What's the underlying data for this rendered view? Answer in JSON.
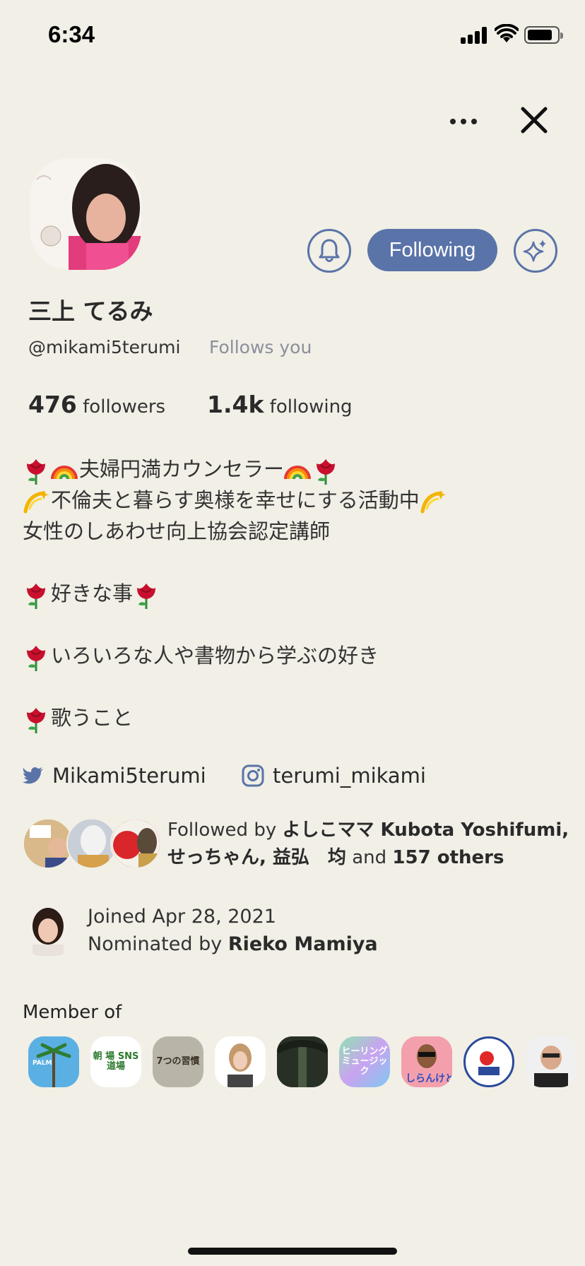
{
  "status": {
    "time": "6:34"
  },
  "profile": {
    "name": "三上 てるみ",
    "handle": "@mikami5terumi",
    "follows_you": "Follows you",
    "following_label": "Following"
  },
  "stats": {
    "followers_count": "476",
    "followers_label": "followers",
    "following_count": "1.4k",
    "following_label": "following"
  },
  "bio": {
    "line1": "夫婦円満カウンセラー",
    "line2": "不倫夫と暮らす奥様を幸せにする活動中",
    "line3": "女性のしあわせ向上協会認定講師",
    "line4": "好きな事",
    "line5": "いろいろな人や書物から学ぶの好き",
    "line6": "歌うこと"
  },
  "social": {
    "twitter": "Mikami5terumi",
    "instagram": "terumi_mikami"
  },
  "followed_by": {
    "prefix": "Followed by",
    "names_line1": "よしこママ Kubota Yoshifumi,",
    "names_line2": "せっちゃん, 益弘　均",
    "and_label": "and",
    "others": "157 others"
  },
  "joined": {
    "joined_text": "Joined Apr 28, 2021",
    "nominated_prefix": "Nominated by",
    "nominator": "Rieko Mamiya"
  },
  "member_of": {
    "label": "Member of",
    "clubs": [
      {
        "icon": "palm-tree-club-icon",
        "text": "PALM"
      },
      {
        "icon": "asaba-sns-club-icon",
        "text": "朝 場 SNS道場"
      },
      {
        "icon": "seven-habits-club-icon",
        "text": "7つの習慣"
      },
      {
        "icon": "portrait-club-icon",
        "text": ""
      },
      {
        "icon": "forest-club-icon",
        "text": ""
      },
      {
        "icon": "healing-music-club-icon",
        "text": "ヒーリング ミュージック"
      },
      {
        "icon": "shiranke-club-icon",
        "text": "しらんけど"
      },
      {
        "icon": "mascot-club-icon",
        "text": ""
      },
      {
        "icon": "man-portrait-club-icon",
        "text": ""
      }
    ]
  },
  "colors": {
    "background": "#f1efe6",
    "accent": "#5a73a8",
    "twitter": "#5a73a8"
  }
}
